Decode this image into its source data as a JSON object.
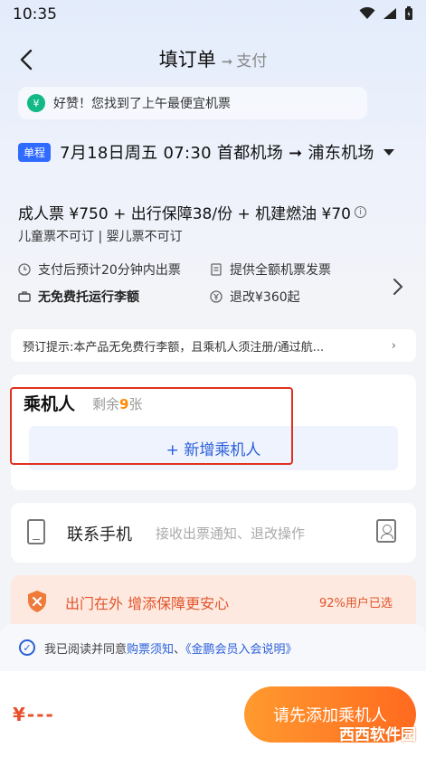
{
  "status_bar": {
    "time": "10:35"
  },
  "nav": {
    "title": "填订单",
    "arrow": "➞",
    "next_step": "支付"
  },
  "banner": {
    "icon_text": "¥",
    "text": "好赞！您找到了上午最便宜机票"
  },
  "flight": {
    "badge": "单程",
    "summary": "7月18日周五 07:30  首都机场 ➞ 浦东机场"
  },
  "price": {
    "line": "成人票 ¥750 + 出行保障38/份 + 机建燃油 ¥70",
    "child_line": "儿童票不可订 | 婴儿票不可订"
  },
  "policies": {
    "issue_time": "支付后预计20分钟内出票",
    "invoice": "提供全额机票发票",
    "baggage": "无免费托运行李额",
    "refund": "退改¥360起"
  },
  "notice": {
    "text": "预订提示:本产品无免费行李额，且乘机人须注册/通过航...",
    "chevron": "›"
  },
  "passenger": {
    "title": "乘机人",
    "remaining_prefix": "剩余",
    "remaining_count": "9",
    "remaining_suffix": "张",
    "add_label": "+ 新增乘机人"
  },
  "contact": {
    "label": "联系手机",
    "placeholder": "接收出票通知、退改操作"
  },
  "insurance": {
    "title": "出门在外 增添保障更安心",
    "right": "92%用户已选"
  },
  "agreement": {
    "prefix": "我已阅读并同意",
    "link1": "购票须知",
    "sep": "、",
    "link2": "《金鹏会员入会说明》"
  },
  "footer": {
    "total": "¥---",
    "submit_label": "请先添加乘机人",
    "watermark": "西西软件园"
  },
  "colors": {
    "accent": "#2a5fd9",
    "orange": "#ff6a1f",
    "highlight": "#e0301e"
  }
}
